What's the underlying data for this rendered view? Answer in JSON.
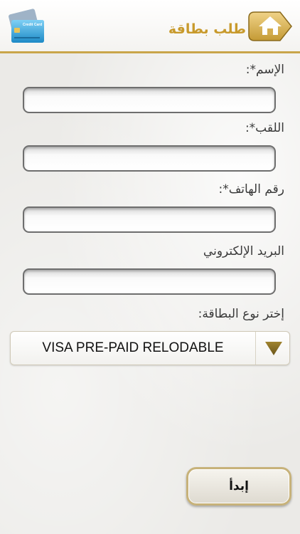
{
  "header": {
    "title": "طلب بطاقة",
    "card_icon_text": "Credit Card",
    "home_icon": "home-icon"
  },
  "form": {
    "first_name_label": "الإسم*:",
    "first_name_value": "",
    "last_name_label": "اللقب*:",
    "last_name_value": "",
    "phone_label": "رقم الهاتف*:",
    "phone_value": "",
    "email_label": "البريد الإلكتروني",
    "email_value": "",
    "card_type_label": "إختر نوع البطاقة:",
    "card_type_selected": "VISA PRE-PAID RELODABLE",
    "start_button": "إبدأ"
  },
  "colors": {
    "accent": "#c89a2c",
    "header_line": "#c9a54a"
  }
}
